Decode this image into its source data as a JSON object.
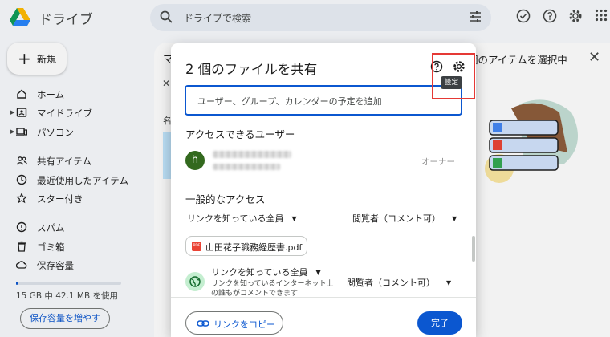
{
  "app": {
    "title": "ドライブ"
  },
  "search": {
    "placeholder": "ドライブで検索"
  },
  "sidebar": {
    "new_label": "新規",
    "items": [
      {
        "label": "ホーム",
        "icon": "home-icon"
      },
      {
        "label": "マイドライブ",
        "icon": "my-drive-icon"
      },
      {
        "label": "パソコン",
        "icon": "computers-icon"
      },
      {
        "label": "共有アイテム",
        "icon": "shared-icon"
      },
      {
        "label": "最近使用したアイテム",
        "icon": "recent-icon"
      },
      {
        "label": "スター付き",
        "icon": "star-icon"
      },
      {
        "label": "スパム",
        "icon": "spam-icon"
      },
      {
        "label": "ゴミ箱",
        "icon": "trash-icon"
      },
      {
        "label": "保存容量",
        "icon": "storage-icon"
      }
    ],
    "storage_text": "15 GB 中 42.1 MB を使用",
    "storage_used_fraction": 0.003,
    "storage_button": "保存容量を増やす"
  },
  "background": {
    "right_panel_title": "個のアイテムを選択中",
    "partial_title": "マ",
    "partial_header": "名"
  },
  "dialog": {
    "title": "2 個のファイルを共有",
    "input_placeholder": "ユーザー、グループ、カレンダーの予定を追加",
    "users_section": "アクセスできるユーザー",
    "user": {
      "avatar_initial": "h",
      "role": "オーナー"
    },
    "general_section": "一般的なアクセス",
    "general_access": "リンクを知っている全員",
    "general_role": "閲覧者（コメント可）",
    "file_chip": "山田花子職務経歴書.pdf",
    "file_access": "リンクを知っている全員",
    "file_access_desc": "リンクを知っているインターネット上の誰もがコメントできます",
    "file_role": "閲覧者（コメント可）",
    "copy_link": "リンクをコピー",
    "done": "完了"
  },
  "tooltip": {
    "settings": "設定"
  },
  "colors": {
    "primary": "#0b57d0",
    "avatar": "#33691e",
    "highlight": "#e53935",
    "pdf": "#ea4335"
  }
}
